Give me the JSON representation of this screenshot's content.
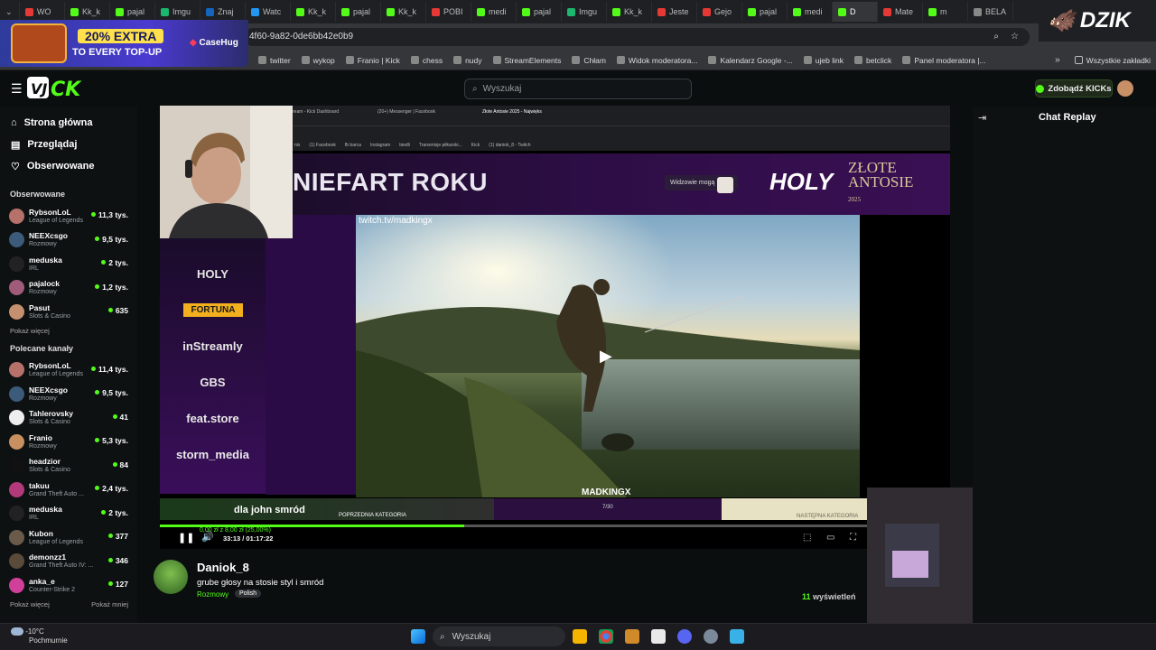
{
  "browser": {
    "tabs": [
      {
        "label": "WO",
        "color": "#e53935"
      },
      {
        "label": "Kk_k",
        "color": "#53fc18"
      },
      {
        "label": "pajal",
        "color": "#53fc18"
      },
      {
        "label": "Imgu",
        "color": "#1bb76e"
      },
      {
        "label": "Znaj",
        "color": "#1565c0"
      },
      {
        "label": "Watc",
        "color": "#2196f3"
      },
      {
        "label": "Kk_k",
        "color": "#53fc18"
      },
      {
        "label": "pajal",
        "color": "#53fc18"
      },
      {
        "label": "Kk_k",
        "color": "#53fc18"
      },
      {
        "label": "POBI",
        "color": "#e53935"
      },
      {
        "label": "medi",
        "color": "#53fc18"
      },
      {
        "label": "pajal",
        "color": "#53fc18"
      },
      {
        "label": "Imgu",
        "color": "#1bb76e"
      },
      {
        "label": "Kk_k",
        "color": "#53fc18"
      },
      {
        "label": "Jeste",
        "color": "#e53935"
      },
      {
        "label": "Gejo",
        "color": "#e53935"
      },
      {
        "label": "pajal",
        "color": "#53fc18"
      },
      {
        "label": "medi",
        "color": "#53fc18"
      },
      {
        "label": "D",
        "color": "#53fc18"
      },
      {
        "label": "Mate",
        "color": "#e53935"
      },
      {
        "label": "m",
        "color": "#53fc18"
      },
      {
        "label": "BELA",
        "color": "#888888"
      }
    ],
    "active_tab_index": 18,
    "url": "4f60-9a82-0de6bb42e0b9",
    "bookmarks": [
      "twitter",
      "wykop",
      "Franio | Kick",
      "chess",
      "nudy",
      "StreamElements",
      "Chłam",
      "Widok moderatora...",
      "Kalendarz Google -...",
      "ujeb link",
      "betclick",
      "Panel moderatora |..."
    ],
    "all_bookmarks": "Wszystkie zakładki"
  },
  "ad": {
    "badge": "20% EXTRA",
    "text": "TO EVERY TOP-UP",
    "brand": "CaseHug"
  },
  "overlay_brand": "DZIK",
  "header": {
    "search_placeholder": "Wyszukaj",
    "kicks_button": "Zdobądź KICKs"
  },
  "nav": [
    {
      "label": "Strona główna",
      "icon": "home-icon"
    },
    {
      "label": "Przeglądaj",
      "icon": "browse-icon"
    },
    {
      "label": "Obserwowane",
      "icon": "heart-icon"
    }
  ],
  "followed": {
    "title": "Obserwowane",
    "channels": [
      {
        "name": "RybsonLoL",
        "category": "League of Legends",
        "viewers": "11,3 tys.",
        "color": "#b5716a"
      },
      {
        "name": "NEEXcsgo",
        "category": "Rozmowy",
        "viewers": "9,5 tys.",
        "color": "#3c5a7a"
      },
      {
        "name": "meduska",
        "category": "IRL",
        "viewers": "2 tys.",
        "color": "#222222"
      },
      {
        "name": "pajalock",
        "category": "Rozmowy",
        "viewers": "1,2 tys.",
        "color": "#a05a7a"
      },
      {
        "name": "Pasut",
        "category": "Slots & Casino",
        "viewers": "635",
        "color": "#c49070"
      }
    ],
    "more": "Pokaż więcej"
  },
  "recommended": {
    "title": "Polecane kanały",
    "channels": [
      {
        "name": "RybsonLoL",
        "category": "League of Legends",
        "viewers": "11,4 tys.",
        "color": "#b5716a"
      },
      {
        "name": "NEEXcsgo",
        "category": "Rozmowy",
        "viewers": "9,5 tys.",
        "color": "#3c5a7a"
      },
      {
        "name": "Tahlerovsky",
        "category": "Slots & Casino",
        "viewers": "41",
        "color": "#eeeeee"
      },
      {
        "name": "Franio",
        "category": "Rozmowy",
        "viewers": "5,3 tys.",
        "color": "#c89060"
      },
      {
        "name": "headzior",
        "category": "Slots & Casino",
        "viewers": "84",
        "color": "#111111"
      },
      {
        "name": "takuu",
        "category": "Grand Theft Auto ...",
        "viewers": "2,4 tys.",
        "color": "#b23a7a"
      },
      {
        "name": "meduska",
        "category": "IRL",
        "viewers": "2 tys.",
        "color": "#222222"
      },
      {
        "name": "Kubon",
        "category": "League of Legends",
        "viewers": "377",
        "color": "#6a5a4a"
      },
      {
        "name": "demonzz1",
        "category": "Grand Theft Auto IV: ...",
        "viewers": "346",
        "color": "#5a4a3a"
      },
      {
        "name": "anka_e",
        "category": "Counter-Strike 2",
        "viewers": "127",
        "color": "#d0409a"
      }
    ],
    "more": "Pokaż więcej",
    "less": "Pokaż mniej"
  },
  "video": {
    "banner": "NIEFART ROKU",
    "spectators_label": "Widzowie mogą",
    "holy": "HOLY",
    "zlote": "ZŁOTE ANTOSIE",
    "zlote_year": "2025",
    "source": "twitch.tv/madkingx",
    "watermark": "MADKINGX",
    "sponsors": [
      "HOLY",
      "FORTUNA",
      "inStreamly",
      "GBS",
      "feat.store",
      "storm_media"
    ],
    "donation_title": "dla john smród",
    "donation_amount": "0,00 zł z 8,00 zł (25,00%)",
    "time": "33:13 / 01:17:22",
    "progress": 0.43,
    "prev_category": "POPRZEDNIA KATEGORIA",
    "next_category": "NASTĘPNA KATEGORIA",
    "counter": "7/30",
    "inner_tabs": [
      "ream - Kick Dashboard",
      "(20+) Messenger | Facebook",
      "Złote Antosie 2025 - Najwięks"
    ],
    "inner_bookmarks": [
      "nix",
      "(1) Facebook",
      "fb barca",
      "Instagram",
      "biedli",
      "Transmisje piłkarski...",
      "Kick",
      "(1) daniok_8 - Twitch"
    ]
  },
  "chat": {
    "title": "Chat Replay"
  },
  "stream": {
    "streamer": "Daniok_8",
    "title": "grube głosy na stosie styl i smród",
    "category": "Rozmowy",
    "language": "Polish",
    "views_count": "11",
    "views_label": "wyświetleń"
  },
  "taskbar": {
    "temp": "-10°C",
    "weather": "Pochmurnie",
    "search": "Wyszukaj"
  }
}
